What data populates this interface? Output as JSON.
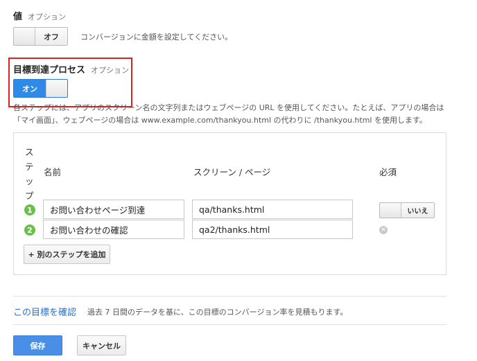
{
  "value_section": {
    "title": "値",
    "optional": "オプション",
    "toggle_label": "オフ",
    "help": "コンバージョンに金額を設定してください。"
  },
  "funnel_section": {
    "title": "目標到達プロセス",
    "optional": "オプション",
    "toggle_label": "オン",
    "help_line1": "各ステップには、アプリのスクリーン名の文字列またはウェブページの URL を使用してください。たとえば、アプリの場合は",
    "help_line2": "「マイ画面」、ウェブページの場合は www.example.com/thankyou.html の代わりに /thankyou.html を使用します。"
  },
  "steps_table": {
    "header_step": "ステップ",
    "header_name": "名前",
    "header_screen": "スクリーン / ページ",
    "header_required": "必須",
    "rows": [
      {
        "num": "1",
        "name": "お問い合わせページ到達",
        "screen": "qa/thanks.html",
        "required": "いいえ"
      },
      {
        "num": "2",
        "name": "お問い合わせの確認",
        "screen": "qa2/thanks.html"
      }
    ],
    "add_step": "+ 別のステップを追加"
  },
  "verify": {
    "link": "この目標を確認",
    "text": "過去 7 日間のデータを基に、この目標のコンバージョン率を見積もります。"
  },
  "actions": {
    "save": "保存",
    "cancel": "キャンセル"
  },
  "colors": {
    "accent": "#2e8ae6",
    "highlight_border": "#e02020",
    "step_badge": "#6cc04a"
  }
}
